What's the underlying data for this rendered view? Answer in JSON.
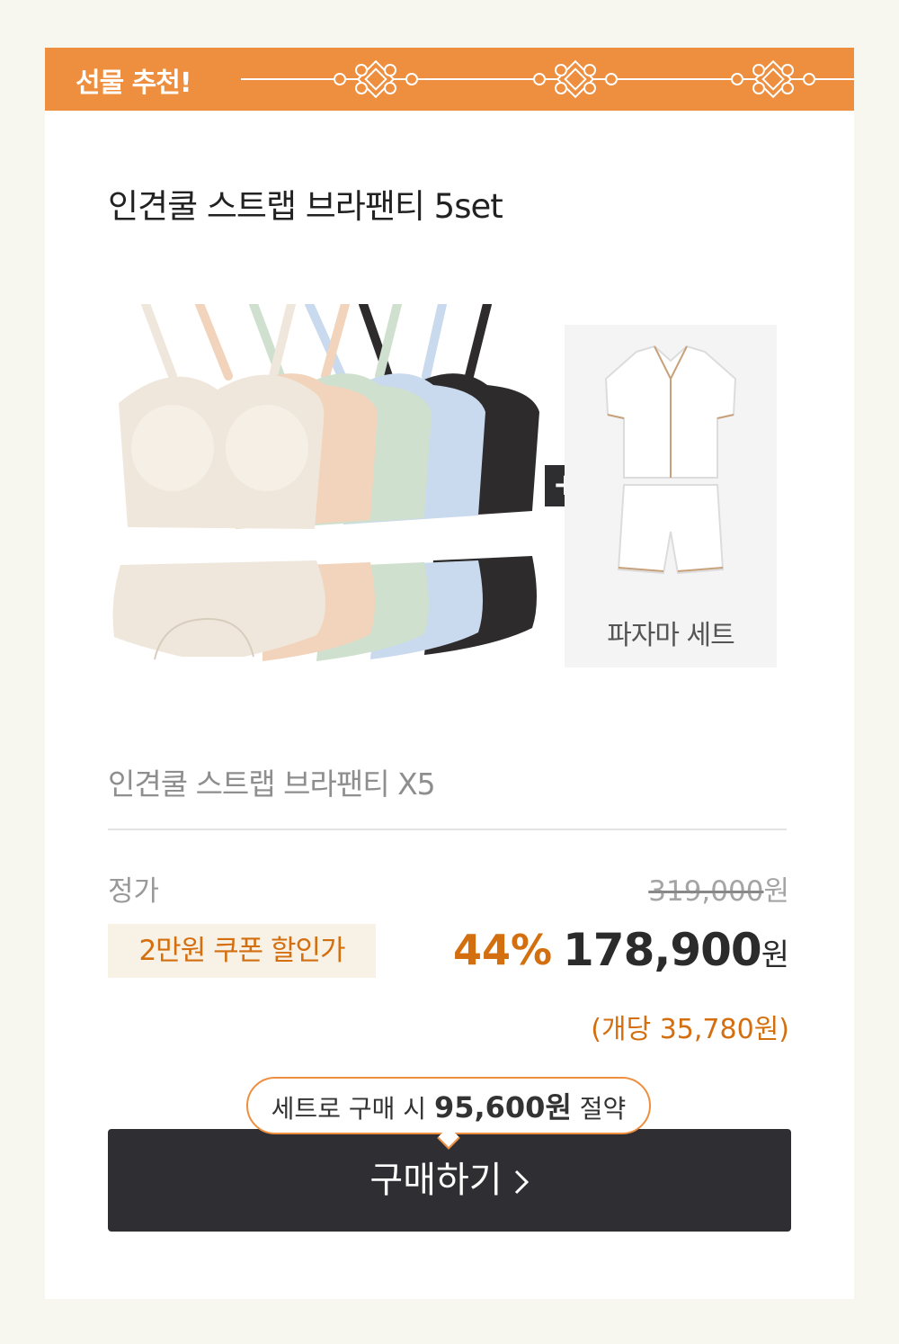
{
  "banner": {
    "title": "선물 추천!"
  },
  "product": {
    "title": "인견쿨 스트랩 브라팬티 5set",
    "gift_label": "파자마 세트",
    "plus_symbol": "+",
    "subtitle": "인견쿨 스트랩 브라팬티 X5",
    "colors": [
      "#efe7dc",
      "#f1d4bb",
      "#cfe0cf",
      "#c9d9ee",
      "#2d2b2b"
    ]
  },
  "pricing": {
    "regular_label": "정가",
    "regular_price": "319,000",
    "currency": "원",
    "coupon_label": "2만원 쿠폰 할인가",
    "discount": "44%",
    "sale_price": "178,900",
    "per_unit": "(개당 35,780원)"
  },
  "savings": {
    "prefix": "세트로 구매 시",
    "amount": "95,600원",
    "suffix": "절약"
  },
  "buy_button": {
    "label": "구매하기"
  },
  "accent_color": "#ee8e3f",
  "highlight_color": "#d36f0f"
}
